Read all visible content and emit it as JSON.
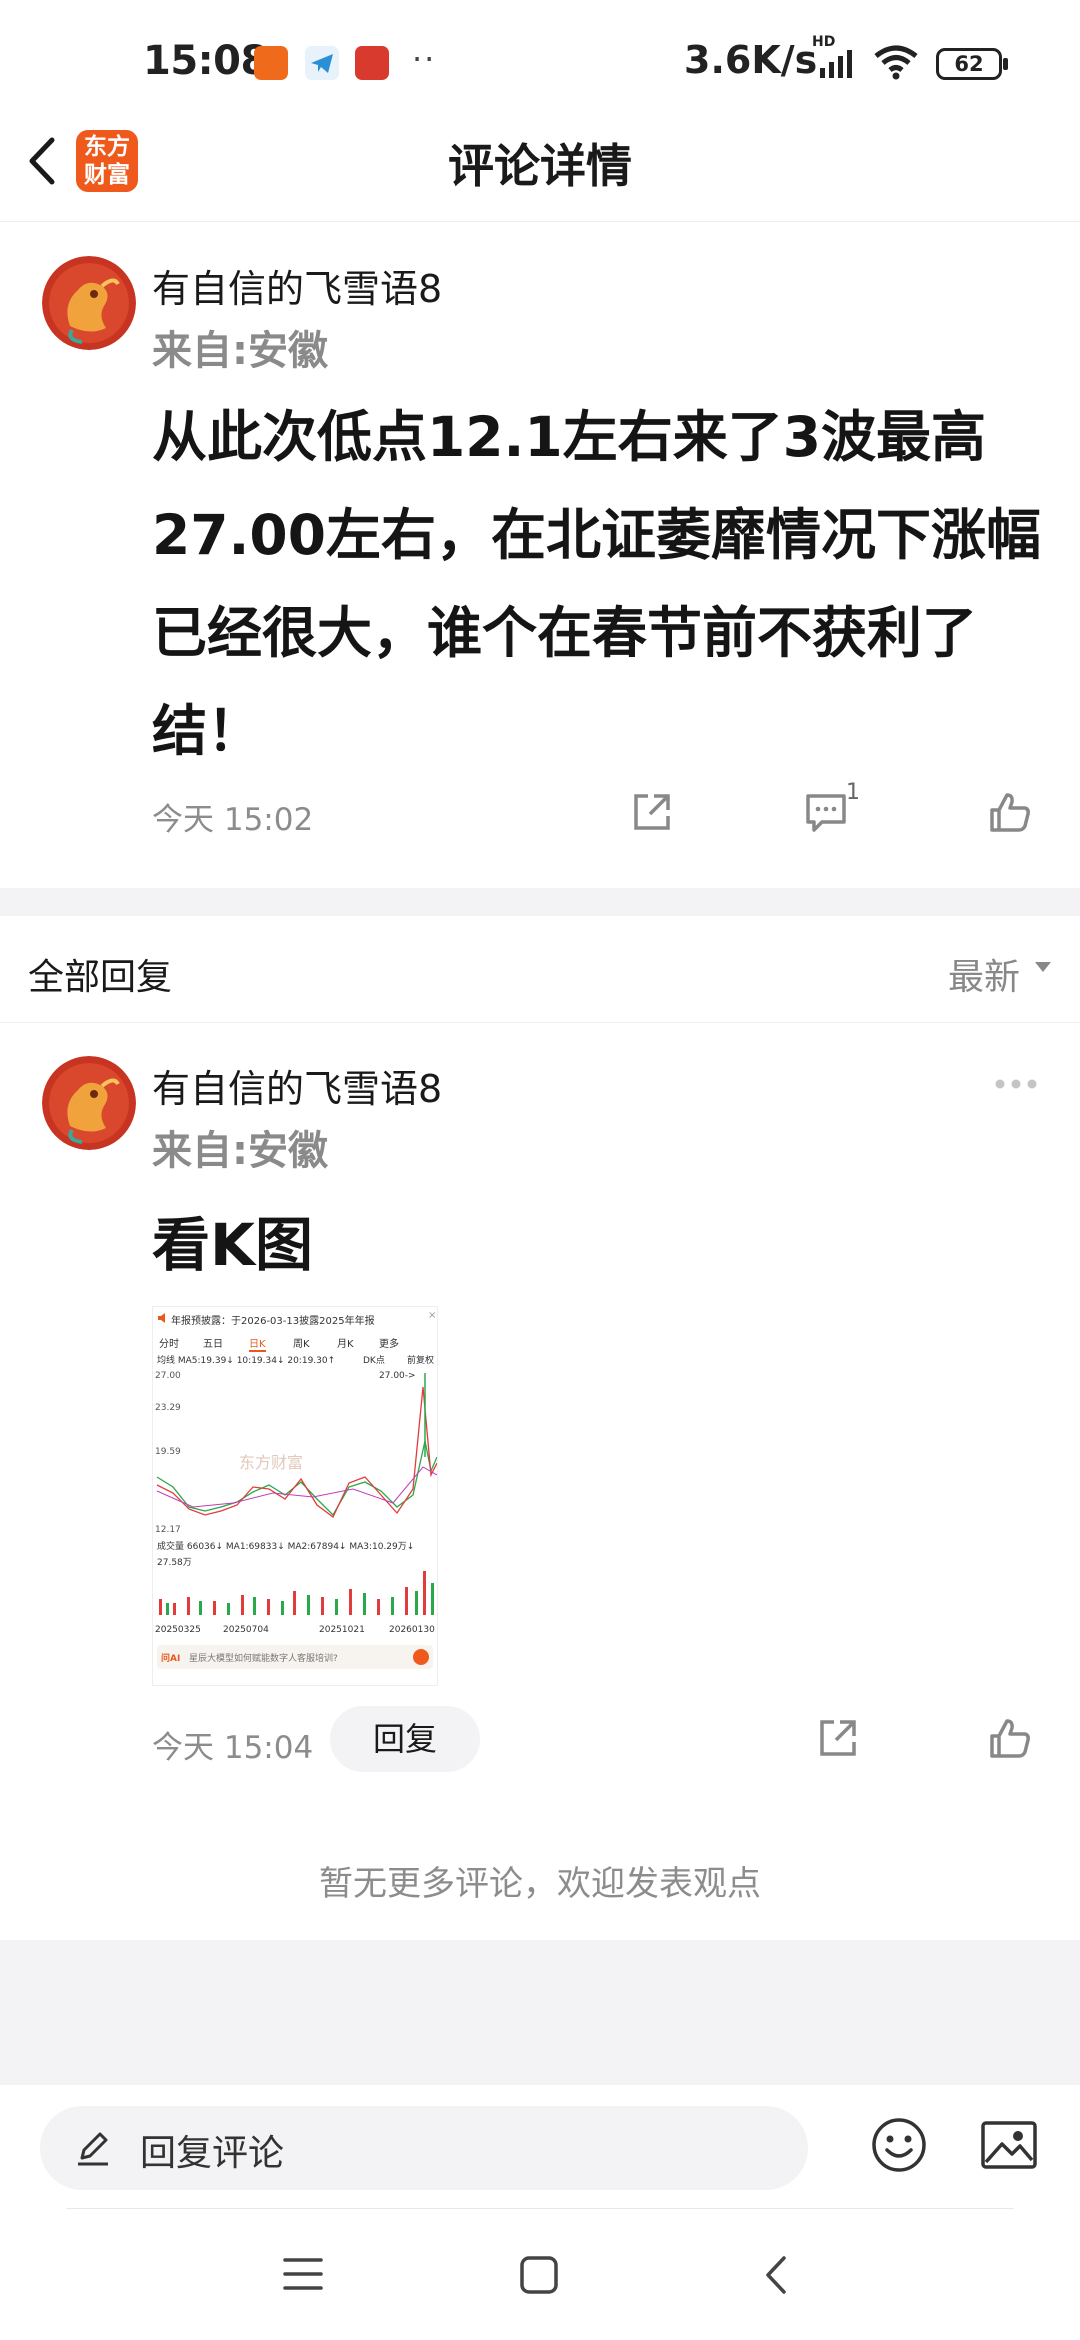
{
  "status_bar": {
    "time": "15:08",
    "net_speed": "3.6K/s",
    "battery": "62",
    "signal_tag": "HD"
  },
  "header": {
    "title": "评论详情",
    "logo_line1": "东方",
    "logo_line2": "财富"
  },
  "post": {
    "username": "有自信的飞雪语8",
    "location": "来自:安徽",
    "text": "从此次低点12.1左右来了3波最高27.00左右，在北证萎靡情况下涨幅已经很大，谁个在春节前不获利了结！",
    "time": "今天 15:02",
    "comment_count": "1"
  },
  "replies_section": {
    "title": "全部回复",
    "sort": "最新"
  },
  "reply": {
    "username": "有自信的飞雪语8",
    "location": "来自:安徽",
    "text": "看K图",
    "time": "今天 15:04",
    "reply_button": "回复"
  },
  "thumbnail": {
    "notice": "年报预披露：于2026-03-13披露2025年年报",
    "tabs": [
      "分时",
      "五日",
      "日K",
      "周K",
      "月K",
      "更多"
    ],
    "ma_line": "均线 MA5:19.39↓ 10:19.34↓ 20:19.30↑",
    "dk": "DK点",
    "fq": "前复权",
    "y_high": "27.00",
    "y_mid1": "23.29",
    "y_mid2": "19.59",
    "y_low": "12.17",
    "peak_label": "27.00->",
    "vol_line": "成交量 66036↓ MA1:69833↓ MA2:67894↓ MA3:10.29万↓",
    "vol_max": "27.58万",
    "dates": [
      "20250325",
      "20250704",
      "20251021",
      "20260130"
    ],
    "ai_prompt": "星辰大模型如何赋能数字人客服培训?",
    "ai_tag": "问AI",
    "watermark": "东方财富"
  },
  "footer": {
    "no_more": "暂无更多评论，欢迎发表观点",
    "input_placeholder": "回复评论"
  },
  "colors": {
    "brand": "#ef5a1c",
    "up_red": "#e23b3b",
    "down_green": "#2aa84a"
  }
}
